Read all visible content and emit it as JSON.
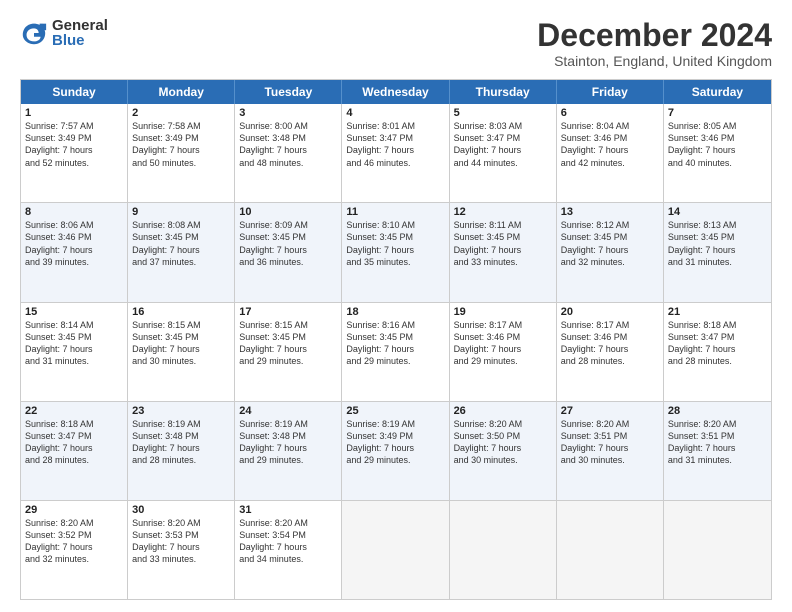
{
  "logo": {
    "general": "General",
    "blue": "Blue"
  },
  "title": "December 2024",
  "subtitle": "Stainton, England, United Kingdom",
  "headers": [
    "Sunday",
    "Monday",
    "Tuesday",
    "Wednesday",
    "Thursday",
    "Friday",
    "Saturday"
  ],
  "rows": [
    [
      {
        "day": "1",
        "text": "Sunrise: 7:57 AM\nSunset: 3:49 PM\nDaylight: 7 hours\nand 52 minutes."
      },
      {
        "day": "2",
        "text": "Sunrise: 7:58 AM\nSunset: 3:49 PM\nDaylight: 7 hours\nand 50 minutes."
      },
      {
        "day": "3",
        "text": "Sunrise: 8:00 AM\nSunset: 3:48 PM\nDaylight: 7 hours\nand 48 minutes."
      },
      {
        "day": "4",
        "text": "Sunrise: 8:01 AM\nSunset: 3:47 PM\nDaylight: 7 hours\nand 46 minutes."
      },
      {
        "day": "5",
        "text": "Sunrise: 8:03 AM\nSunset: 3:47 PM\nDaylight: 7 hours\nand 44 minutes."
      },
      {
        "day": "6",
        "text": "Sunrise: 8:04 AM\nSunset: 3:46 PM\nDaylight: 7 hours\nand 42 minutes."
      },
      {
        "day": "7",
        "text": "Sunrise: 8:05 AM\nSunset: 3:46 PM\nDaylight: 7 hours\nand 40 minutes."
      }
    ],
    [
      {
        "day": "8",
        "text": "Sunrise: 8:06 AM\nSunset: 3:46 PM\nDaylight: 7 hours\nand 39 minutes."
      },
      {
        "day": "9",
        "text": "Sunrise: 8:08 AM\nSunset: 3:45 PM\nDaylight: 7 hours\nand 37 minutes."
      },
      {
        "day": "10",
        "text": "Sunrise: 8:09 AM\nSunset: 3:45 PM\nDaylight: 7 hours\nand 36 minutes."
      },
      {
        "day": "11",
        "text": "Sunrise: 8:10 AM\nSunset: 3:45 PM\nDaylight: 7 hours\nand 35 minutes."
      },
      {
        "day": "12",
        "text": "Sunrise: 8:11 AM\nSunset: 3:45 PM\nDaylight: 7 hours\nand 33 minutes."
      },
      {
        "day": "13",
        "text": "Sunrise: 8:12 AM\nSunset: 3:45 PM\nDaylight: 7 hours\nand 32 minutes."
      },
      {
        "day": "14",
        "text": "Sunrise: 8:13 AM\nSunset: 3:45 PM\nDaylight: 7 hours\nand 31 minutes."
      }
    ],
    [
      {
        "day": "15",
        "text": "Sunrise: 8:14 AM\nSunset: 3:45 PM\nDaylight: 7 hours\nand 31 minutes."
      },
      {
        "day": "16",
        "text": "Sunrise: 8:15 AM\nSunset: 3:45 PM\nDaylight: 7 hours\nand 30 minutes."
      },
      {
        "day": "17",
        "text": "Sunrise: 8:15 AM\nSunset: 3:45 PM\nDaylight: 7 hours\nand 29 minutes."
      },
      {
        "day": "18",
        "text": "Sunrise: 8:16 AM\nSunset: 3:45 PM\nDaylight: 7 hours\nand 29 minutes."
      },
      {
        "day": "19",
        "text": "Sunrise: 8:17 AM\nSunset: 3:46 PM\nDaylight: 7 hours\nand 29 minutes."
      },
      {
        "day": "20",
        "text": "Sunrise: 8:17 AM\nSunset: 3:46 PM\nDaylight: 7 hours\nand 28 minutes."
      },
      {
        "day": "21",
        "text": "Sunrise: 8:18 AM\nSunset: 3:47 PM\nDaylight: 7 hours\nand 28 minutes."
      }
    ],
    [
      {
        "day": "22",
        "text": "Sunrise: 8:18 AM\nSunset: 3:47 PM\nDaylight: 7 hours\nand 28 minutes."
      },
      {
        "day": "23",
        "text": "Sunrise: 8:19 AM\nSunset: 3:48 PM\nDaylight: 7 hours\nand 28 minutes."
      },
      {
        "day": "24",
        "text": "Sunrise: 8:19 AM\nSunset: 3:48 PM\nDaylight: 7 hours\nand 29 minutes."
      },
      {
        "day": "25",
        "text": "Sunrise: 8:19 AM\nSunset: 3:49 PM\nDaylight: 7 hours\nand 29 minutes."
      },
      {
        "day": "26",
        "text": "Sunrise: 8:20 AM\nSunset: 3:50 PM\nDaylight: 7 hours\nand 30 minutes."
      },
      {
        "day": "27",
        "text": "Sunrise: 8:20 AM\nSunset: 3:51 PM\nDaylight: 7 hours\nand 30 minutes."
      },
      {
        "day": "28",
        "text": "Sunrise: 8:20 AM\nSunset: 3:51 PM\nDaylight: 7 hours\nand 31 minutes."
      }
    ],
    [
      {
        "day": "29",
        "text": "Sunrise: 8:20 AM\nSunset: 3:52 PM\nDaylight: 7 hours\nand 32 minutes."
      },
      {
        "day": "30",
        "text": "Sunrise: 8:20 AM\nSunset: 3:53 PM\nDaylight: 7 hours\nand 33 minutes."
      },
      {
        "day": "31",
        "text": "Sunrise: 8:20 AM\nSunset: 3:54 PM\nDaylight: 7 hours\nand 34 minutes."
      },
      {
        "day": "",
        "text": ""
      },
      {
        "day": "",
        "text": ""
      },
      {
        "day": "",
        "text": ""
      },
      {
        "day": "",
        "text": ""
      }
    ]
  ]
}
